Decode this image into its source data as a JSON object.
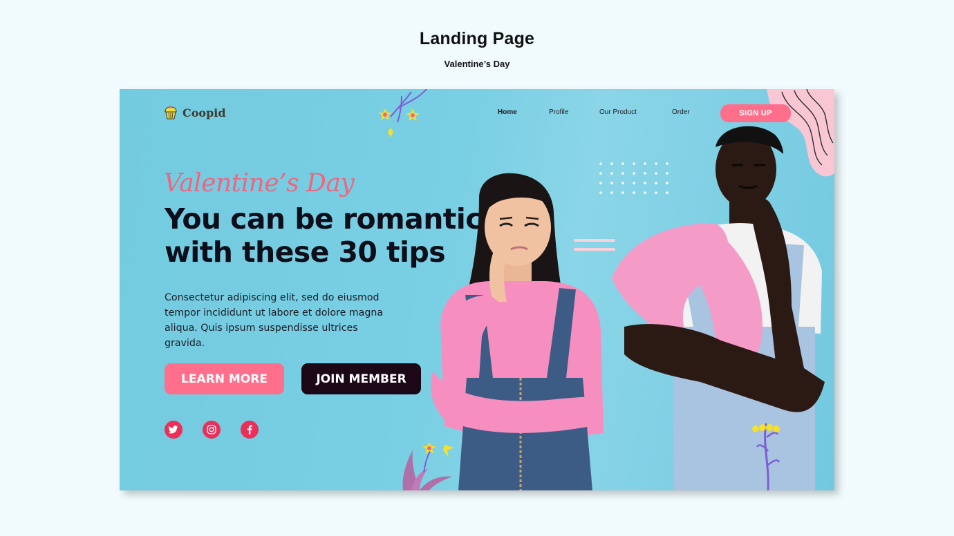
{
  "page": {
    "title": "Landing Page",
    "subtitle": "Valentine’s Day"
  },
  "brand": {
    "name": "Coopid",
    "icon": "cupcake-icon"
  },
  "nav": {
    "items": [
      {
        "label": "Home",
        "active": true
      },
      {
        "label": "Profile",
        "active": false
      },
      {
        "label": "Our Product",
        "active": false
      },
      {
        "label": "Order",
        "active": false
      }
    ],
    "signup_label": "SIGN UP"
  },
  "hero": {
    "eyebrow": "Valentine’s Day",
    "headline_line1": "You can be romantic",
    "headline_line2": "with these 30 tips",
    "body_line1": "Consectetur adipiscing elit, sed do eiusmod",
    "body_line2": "tempor incididunt ut labore et dolore magna",
    "body_line3": "aliqua. Quis ipsum suspendisse ultrices gravida.",
    "learn_more_label": "LEARN MORE",
    "join_member_label": "JOIN MEMBER"
  },
  "social": [
    {
      "icon": "twitter-icon"
    },
    {
      "icon": "instagram-icon"
    },
    {
      "icon": "facebook-icon"
    }
  ],
  "colors": {
    "background": "#f1fbfd",
    "card": "#73cbe0",
    "accent_pink": "#ff6f8c",
    "dark_button": "#1c0717",
    "social_red": "#ec2f58"
  }
}
